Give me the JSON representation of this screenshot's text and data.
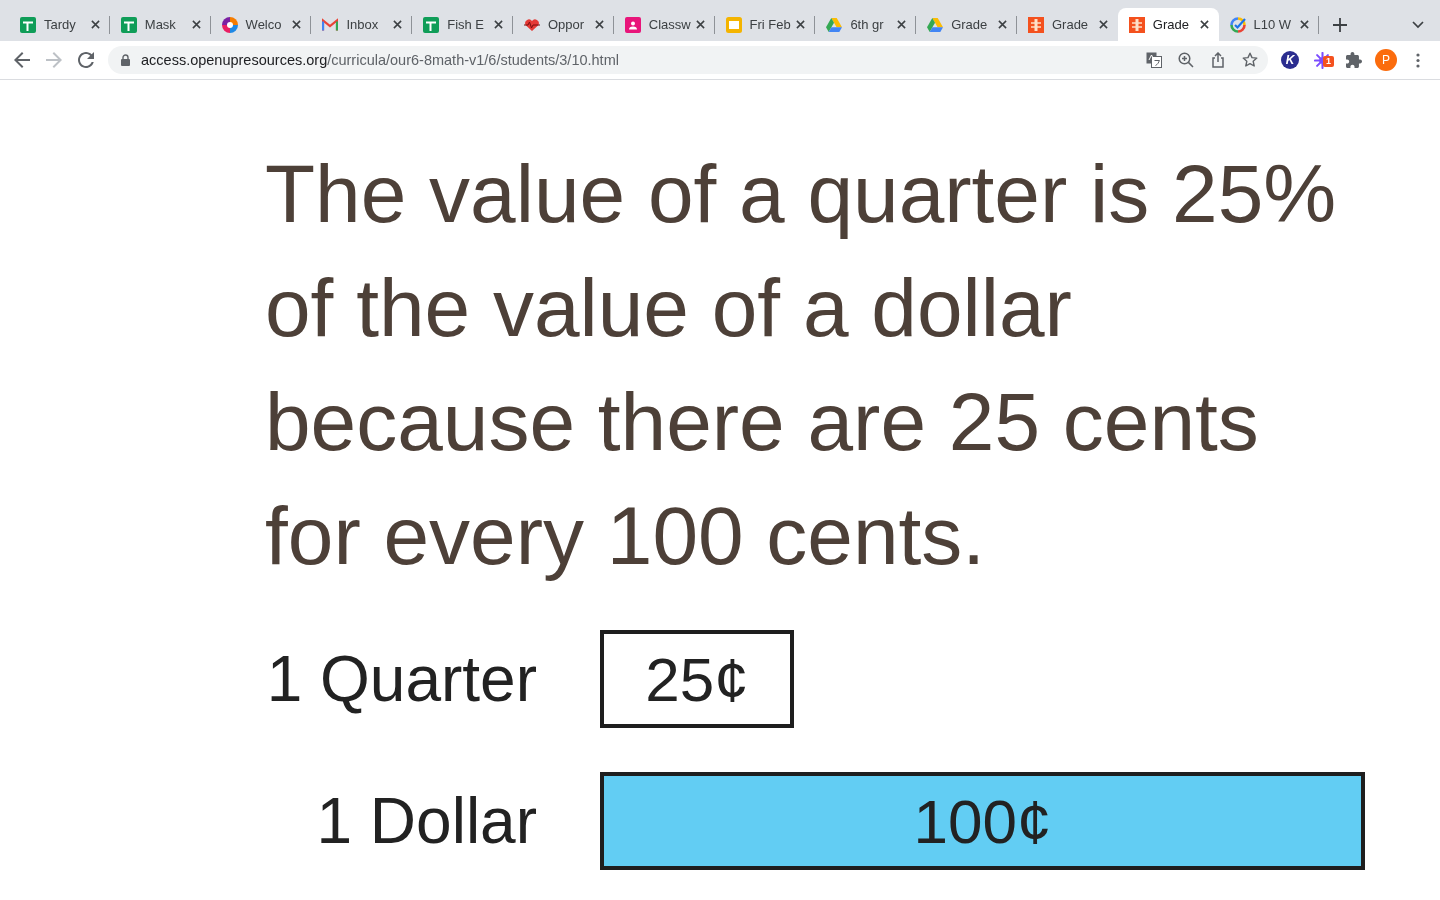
{
  "tabs": [
    {
      "kind": "sheet",
      "title": "Tardy",
      "selected": false
    },
    {
      "kind": "sheet",
      "title": "Mask",
      "selected": false
    },
    {
      "kind": "pinwheel",
      "title": "Welco",
      "selected": false
    },
    {
      "kind": "mail",
      "title": "Inbox",
      "selected": false
    },
    {
      "kind": "sheet",
      "title": "Fish E",
      "selected": false
    },
    {
      "kind": "heart",
      "title": "Oppor",
      "selected": false
    },
    {
      "kind": "classroom",
      "title": "Classw",
      "selected": false
    },
    {
      "kind": "slides",
      "title": "Fri Feb",
      "selected": false
    },
    {
      "kind": "drive",
      "title": "6th gr",
      "selected": false
    },
    {
      "kind": "drive",
      "title": "Grade",
      "selected": false
    },
    {
      "kind": "grader",
      "title": "Grade",
      "selected": false
    },
    {
      "kind": "grader",
      "title": "Grade",
      "selected": true
    },
    {
      "kind": "check",
      "title": "L10 W",
      "selected": false
    }
  ],
  "toolbar": {
    "nav": [
      {
        "kind": "back",
        "disabled": false
      },
      {
        "kind": "forward",
        "disabled": true
      },
      {
        "kind": "reload",
        "disabled": false
      }
    ],
    "address": {
      "host": "access.openupresources.org",
      "path": "/curricula/our6-8math-v1/6/students/3/10.html"
    },
    "extensions": [
      {
        "kind": "monogram",
        "text": "K"
      },
      {
        "kind": "sparkle",
        "badge": "1"
      },
      {
        "kind": "puzzle"
      }
    ],
    "profile": {
      "initial": "P"
    }
  },
  "page": {
    "statement": "The value of a quarter is 25% of the value of a dollar because there are 25 cents for every 100 cents.",
    "tape": [
      {
        "label": "1 Quarter",
        "value": "25¢",
        "color": "#ffffff"
      },
      {
        "label": "1 Dollar",
        "value": "100¢",
        "color": "#62cdf3"
      }
    ]
  }
}
